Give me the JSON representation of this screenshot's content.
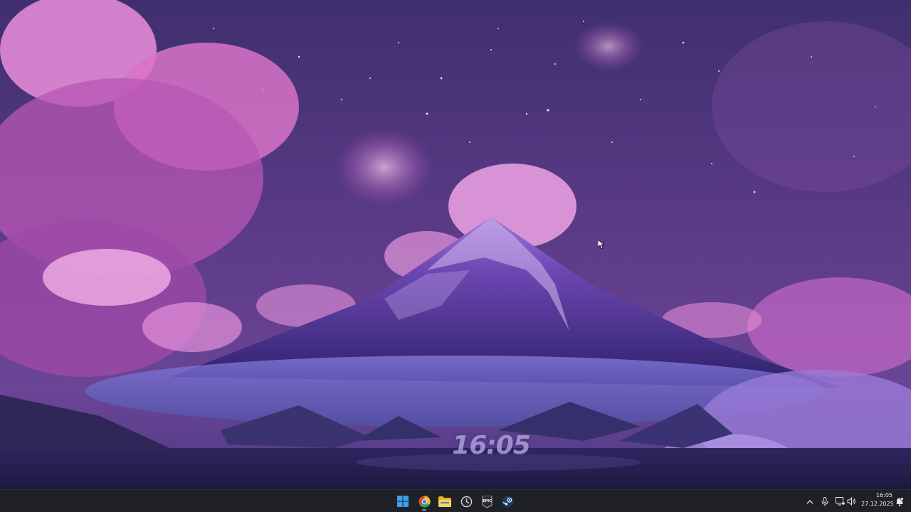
{
  "desktop": {
    "clock_widget": "16:05"
  },
  "taskbar": {
    "apps": [
      {
        "name": "start-button",
        "icon": "windows-logo-icon"
      },
      {
        "name": "taskbar-chrome",
        "icon": "chrome-icon",
        "running": true
      },
      {
        "name": "taskbar-file-explorer",
        "icon": "folder-icon"
      },
      {
        "name": "taskbar-app-circle",
        "icon": "circle-app-icon"
      },
      {
        "name": "taskbar-epic-games",
        "icon": "epic-games-icon"
      },
      {
        "name": "taskbar-steam",
        "icon": "steam-icon"
      }
    ],
    "tray": {
      "time": "16:05",
      "date": "27.12.2025"
    }
  },
  "colors": {
    "taskbar_bg": "#202127",
    "sky_top": "#4a2f78",
    "cloud_pink": "#e27bd0",
    "mountain": "#3b2a7a"
  }
}
